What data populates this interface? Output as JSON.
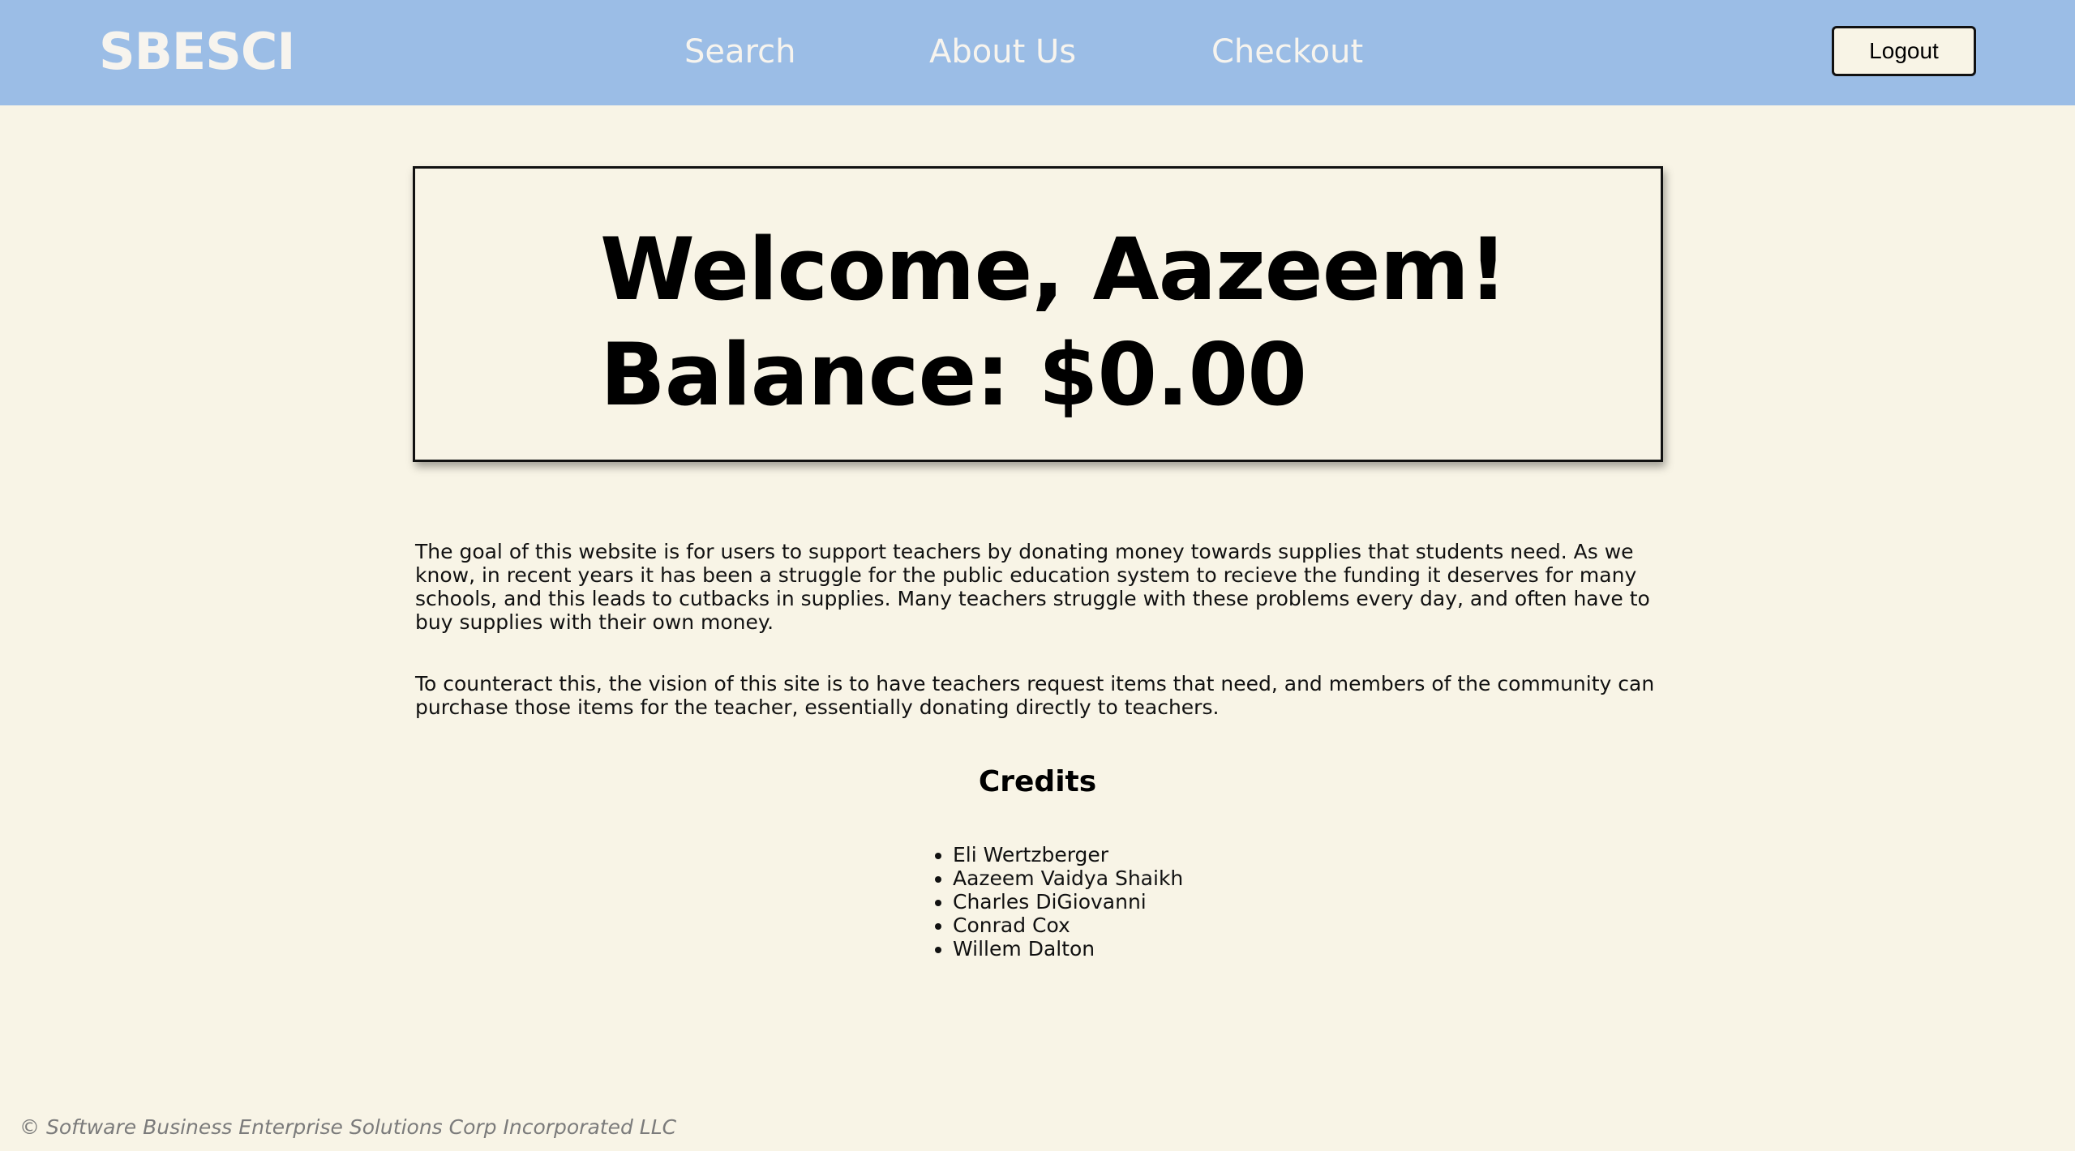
{
  "nav": {
    "brand": "SBESCI",
    "links": [
      "Search",
      "About Us",
      "Checkout"
    ],
    "logout_label": "Logout"
  },
  "welcome": {
    "greeting": "Welcome, Aazeem!",
    "balance": "Balance: $0.00"
  },
  "about": {
    "paragraph1": "The goal of this website is for users to support teachers by donating money towards supplies that students need. As we know, in recent years it has been a struggle for the public education system to recieve the funding it deserves for many schools, and this leads to cutbacks in supplies. Many teachers struggle with these problems every day, and often have to buy supplies with their own money.",
    "paragraph2": "To counteract this, the vision of this site is to have teachers request items that need, and members of the community can purchase those items for the teacher, essentially donating directly to teachers."
  },
  "credits": {
    "title": "Credits",
    "names": [
      "Eli Wertzberger",
      "Aazeem Vaidya Shaikh",
      "Charles DiGiovanni",
      "Conrad Cox",
      "Willem Dalton"
    ]
  },
  "footer": {
    "copyright": "© Software Business Enterprise Solutions Corp Incorporated LLC"
  },
  "colors": {
    "nav_background": "#9bbde6",
    "page_background": "#f8f4e6",
    "nav_text": "#f7f4ee",
    "footer_text": "#7b7b7b"
  }
}
